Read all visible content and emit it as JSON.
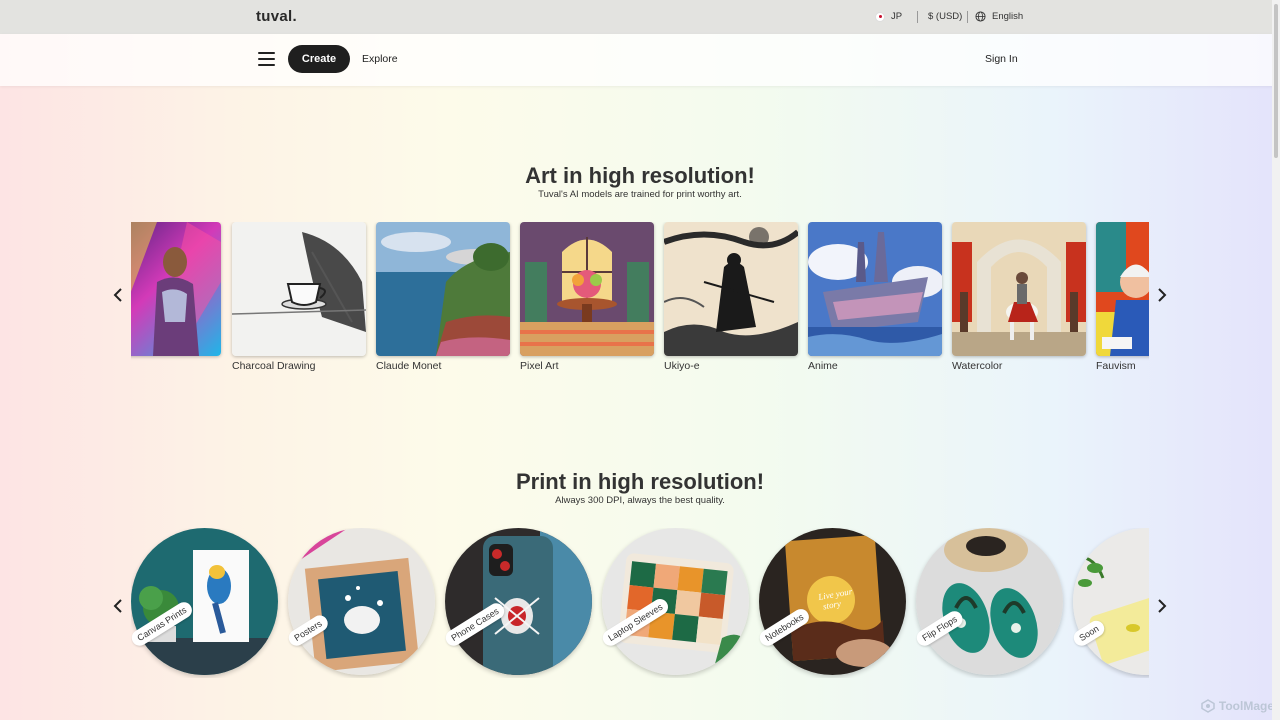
{
  "topbar": {
    "logo": "tuval.",
    "region": "JP",
    "currency": "$ (USD)",
    "language": "English"
  },
  "nav": {
    "create_label": "Create",
    "explore_label": "Explore",
    "signin_label": "Sign In"
  },
  "art_section": {
    "title": "Art in high resolution!",
    "subtitle": "Tuval's AI models are trained for print worthy art.",
    "items": [
      {
        "label": ""
      },
      {
        "label": "Charcoal Drawing"
      },
      {
        "label": "Claude Monet"
      },
      {
        "label": "Pixel Art"
      },
      {
        "label": "Ukiyo-e"
      },
      {
        "label": "Anime"
      },
      {
        "label": "Watercolor"
      },
      {
        "label": "Fauvism"
      }
    ]
  },
  "print_section": {
    "title": "Print in high resolution!",
    "subtitle": "Always 300 DPI, always the best quality.",
    "items": [
      {
        "label": "Canvas Prints"
      },
      {
        "label": "Posters"
      },
      {
        "label": "Phone Cases"
      },
      {
        "label": "Laptop Sleeves"
      },
      {
        "label": "Notebooks"
      },
      {
        "label": "Flip Flops"
      },
      {
        "label": "Soon"
      }
    ],
    "notebook_cover_text": "Live your story"
  },
  "watermark": "ToolMage",
  "colors": {
    "create_button": "#1f1f1f",
    "topbar": "#e3e3e0"
  }
}
